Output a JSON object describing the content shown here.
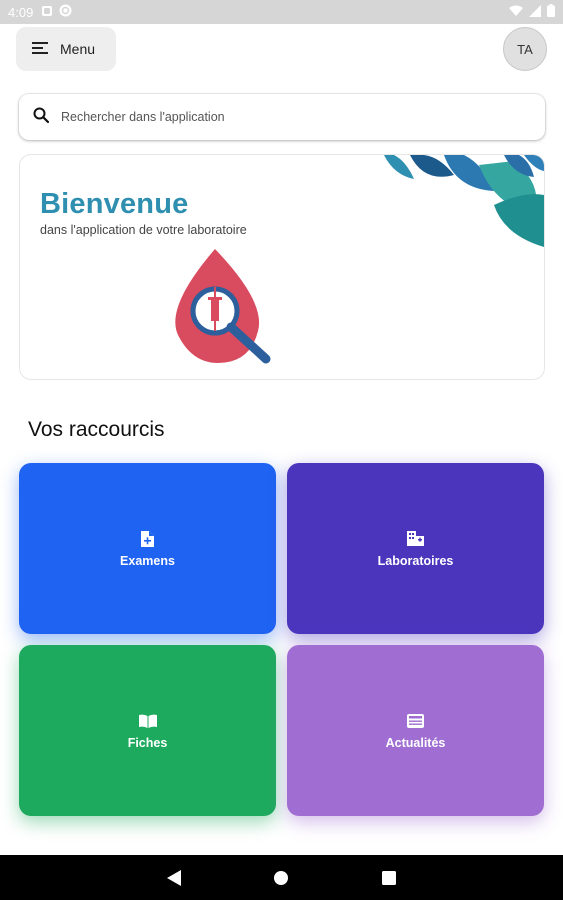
{
  "status_bar": {
    "time": "4:09"
  },
  "header": {
    "menu_label": "Menu",
    "avatar_initials": "TA"
  },
  "search": {
    "placeholder": "Rechercher dans l'application"
  },
  "welcome": {
    "title": "Bienvenue",
    "subtitle": "dans l'application de votre laboratoire"
  },
  "shortcuts": {
    "section_title": "Vos raccourcis",
    "items": [
      {
        "label": "Examens",
        "icon": "file-icon",
        "color": "#1f63f2"
      },
      {
        "label": "Laboratoires",
        "icon": "building-icon",
        "color": "#4b35bd"
      },
      {
        "label": "Fiches",
        "icon": "book-icon",
        "color": "#1eaa5e"
      },
      {
        "label": "Actualités",
        "icon": "news-icon",
        "color": "#a06ed2"
      }
    ]
  },
  "colors": {
    "title_accent": "#2f8fb0",
    "drop_red": "#d94b5e",
    "magnifier_blue": "#2c5f9c"
  }
}
